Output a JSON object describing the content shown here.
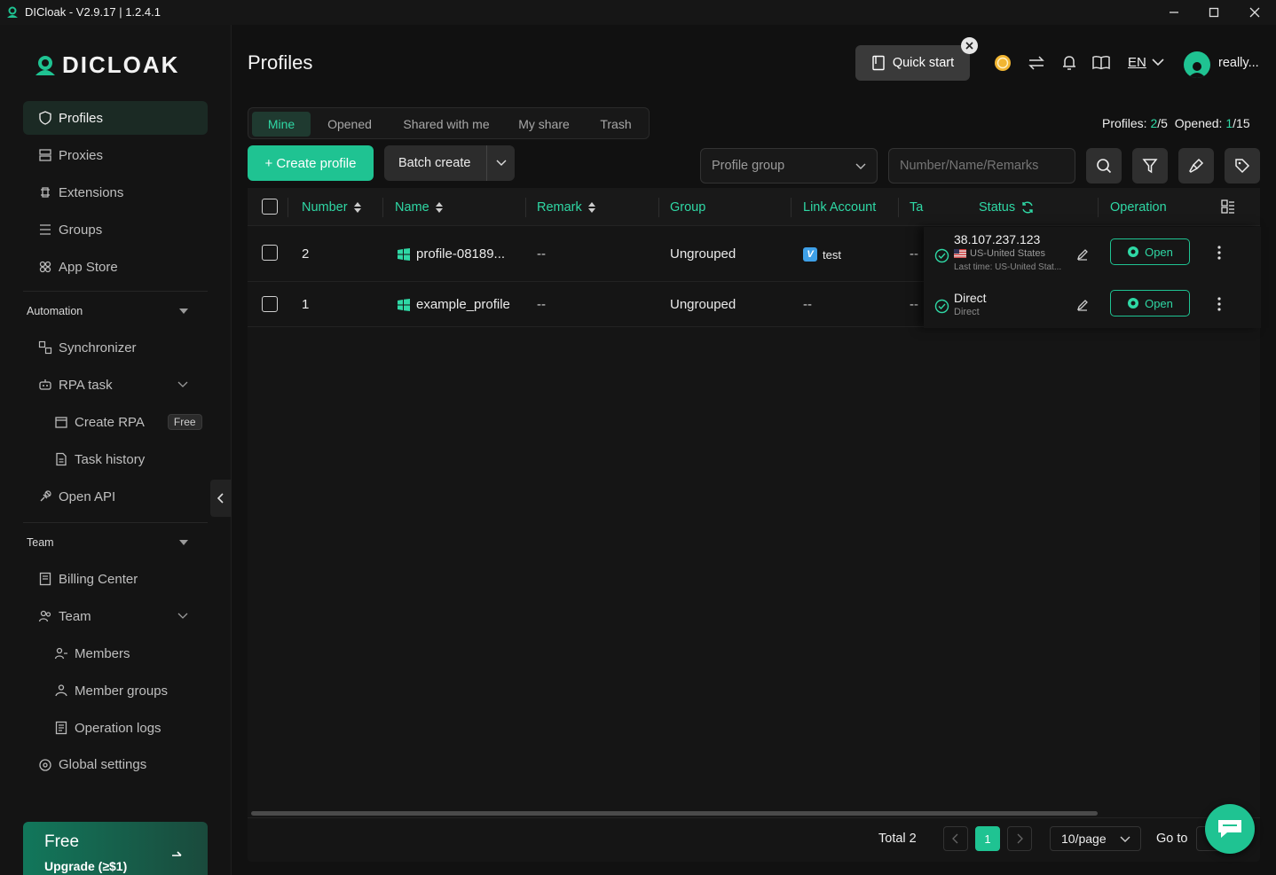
{
  "window": {
    "title": "DICloak - V2.9.17 | 1.2.4.1"
  },
  "brand": {
    "logo_text": "DICLOAK",
    "accent": "#1fc392"
  },
  "sidebar": {
    "items": [
      {
        "label": "Profiles",
        "icon": "shield-icon"
      },
      {
        "label": "Proxies",
        "icon": "proxy-icon"
      },
      {
        "label": "Extensions",
        "icon": "extension-icon"
      },
      {
        "label": "Groups",
        "icon": "groups-icon"
      },
      {
        "label": "App Store",
        "icon": "app-store-icon"
      }
    ],
    "automation": {
      "heading": "Automation",
      "synchronizer": "Synchronizer",
      "rpa_task": "RPA task",
      "create_rpa": "Create RPA",
      "free_badge": "Free",
      "task_history": "Task history",
      "open_api": "Open API"
    },
    "team": {
      "heading": "Team",
      "billing_center": "Billing Center",
      "team": "Team",
      "members": "Members",
      "member_groups": "Member groups",
      "operation_logs": "Operation logs",
      "global_settings": "Global settings"
    },
    "upgrade": {
      "plan": "Free",
      "cta": "Upgrade (≥$1)"
    }
  },
  "header": {
    "page_title": "Profiles",
    "quick_start": "Quick start",
    "language": "EN",
    "username": "really..."
  },
  "tabs": [
    "Mine",
    "Opened",
    "Shared with me",
    "My share",
    "Trash"
  ],
  "stats": {
    "profiles_label": "Profiles:",
    "profiles_value": "2",
    "profiles_total": "/5",
    "opened_label": "Opened:",
    "opened_value": "1",
    "opened_total": "/15"
  },
  "toolbar": {
    "create_profile": "+ Create profile",
    "batch_create": "Batch create",
    "group_placeholder": "Profile group",
    "search_placeholder": "Number/Name/Remarks"
  },
  "table": {
    "columns": {
      "number": "Number",
      "name": "Name",
      "remark": "Remark",
      "group": "Group",
      "link_account": "Link Account",
      "tags": "Ta",
      "status": "Status",
      "operation": "Operation"
    },
    "rows": [
      {
        "number": "2",
        "name": "profile-08189...",
        "remark": "--",
        "group": "Ungrouped",
        "link_account": "test",
        "link_badge": "V",
        "tags": "--",
        "proxy": "38.107.237.123",
        "location": "US-United States",
        "last_time": "Last time: US-United Stat...",
        "open": "Open"
      },
      {
        "number": "1",
        "name": "example_profile",
        "remark": "--",
        "group": "Ungrouped",
        "link_account": "--",
        "tags": "--",
        "proxy": "Direct",
        "location": "Direct",
        "open": "Open"
      }
    ]
  },
  "pagination": {
    "total": "Total 2",
    "current_page": "1",
    "page_size": "10/page",
    "goto": "Go to"
  }
}
